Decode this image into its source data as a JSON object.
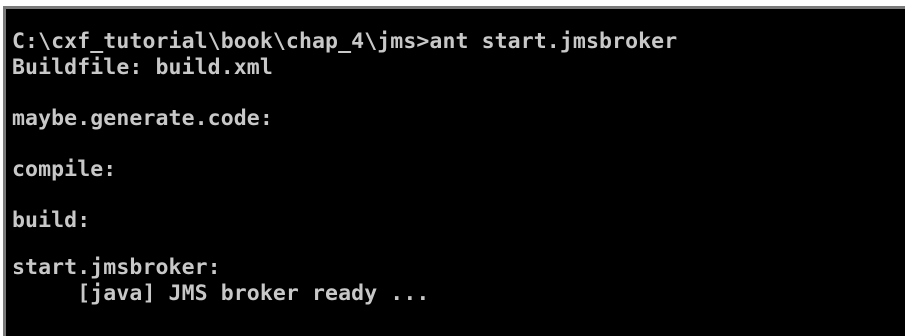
{
  "console": {
    "background": "#000000",
    "text_color": "#c8c8c8",
    "lines": [
      "C:\\cxf_tutorial\\book\\chap_4\\jms>ant start.jmsbroker",
      "Buildfile: build.xml",
      "",
      "maybe.generate.code:",
      "",
      "compile:",
      "",
      "build:",
      "",
      "start.jmsbroker:",
      "     [java] JMS broker ready ..."
    ]
  }
}
